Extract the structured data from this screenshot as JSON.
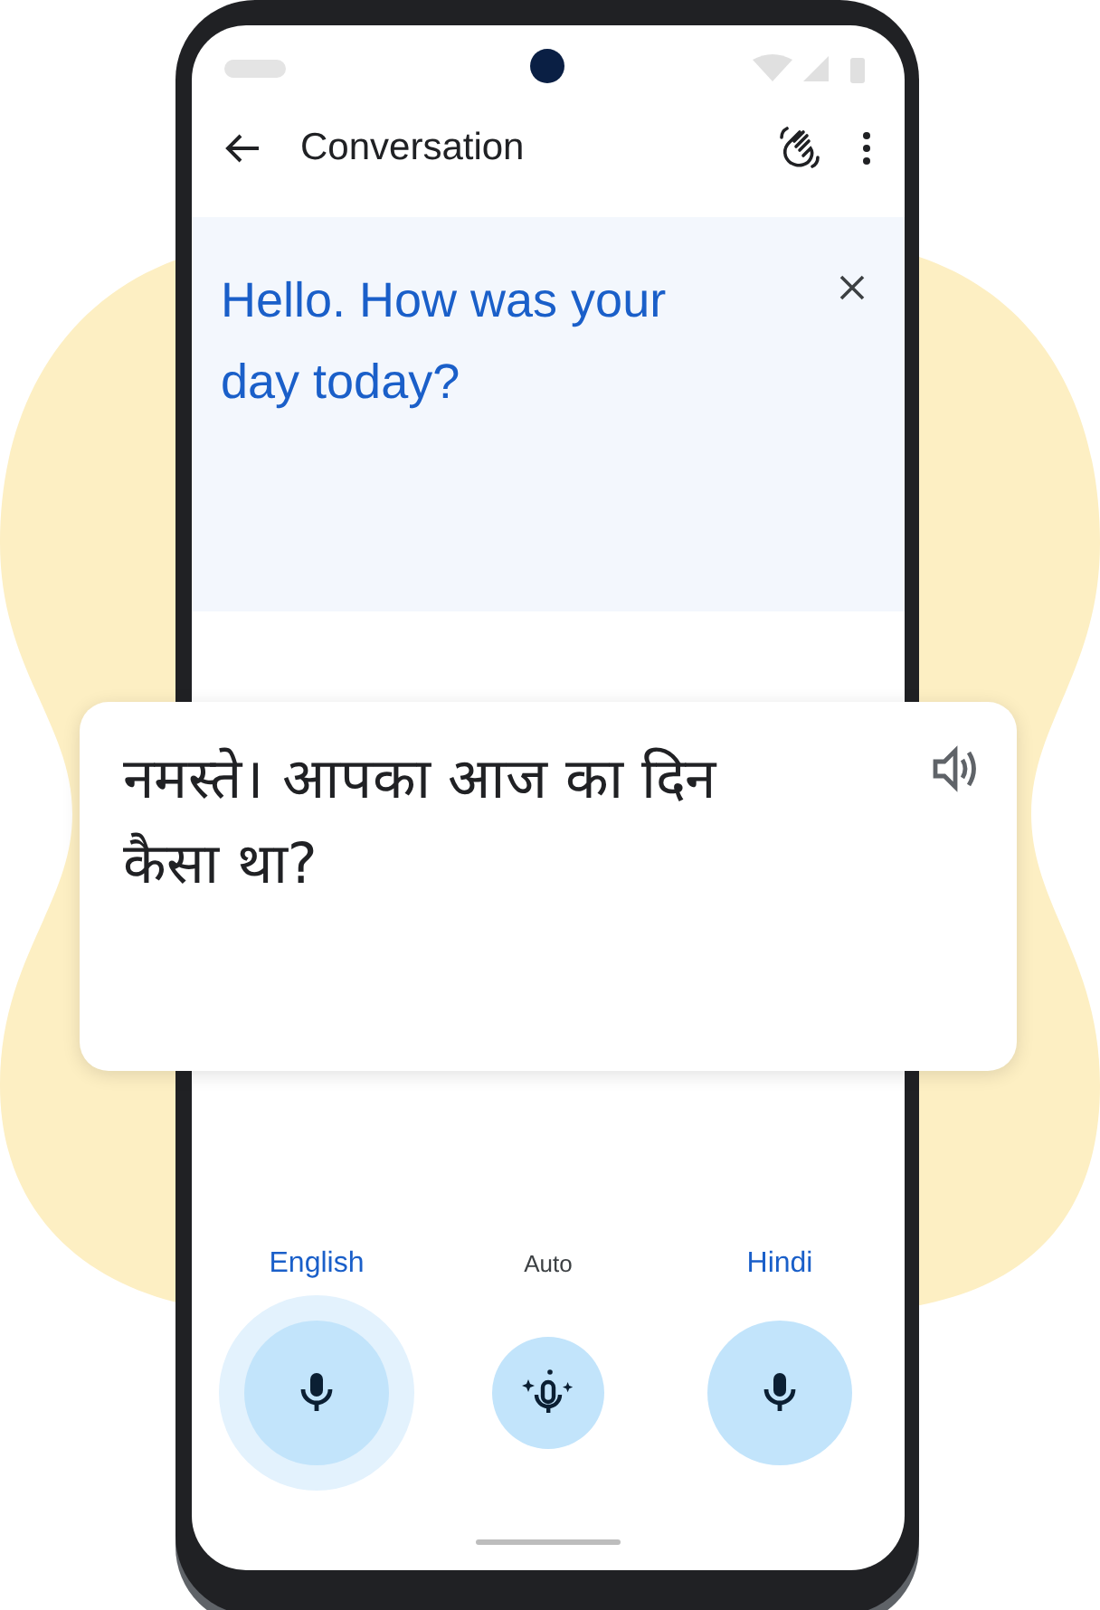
{
  "app_bar": {
    "title": "Conversation"
  },
  "source_panel": {
    "text": "Hello. How was your day today?"
  },
  "translation_card": {
    "text": "नमस्ते। आपका आज का दिन कैसा था?"
  },
  "languages": [
    {
      "label": "English",
      "kind": "language",
      "selected": true
    },
    {
      "label": "Auto",
      "kind": "auto",
      "selected": false
    },
    {
      "label": "Hindi",
      "kind": "language",
      "selected": false
    }
  ]
}
